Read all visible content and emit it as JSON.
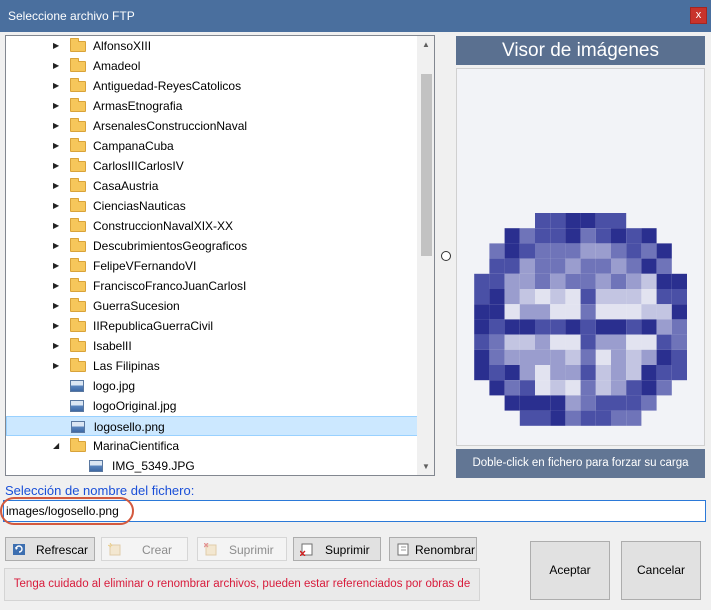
{
  "window": {
    "title": "Seleccione archivo FTP",
    "close_label": "x"
  },
  "tree": {
    "items": [
      {
        "label": "AlfonsoXIII",
        "type": "folder",
        "expander": "▶",
        "depth": 1
      },
      {
        "label": "Amadeol",
        "type": "folder",
        "expander": "▶",
        "depth": 1
      },
      {
        "label": "Antiguedad-ReyesCatolicos",
        "type": "folder",
        "expander": "▶",
        "depth": 1
      },
      {
        "label": "ArmasEtnografia",
        "type": "folder",
        "expander": "▶",
        "depth": 1
      },
      {
        "label": "ArsenalesConstruccionNaval",
        "type": "folder",
        "expander": "▶",
        "depth": 1
      },
      {
        "label": "CampanaCuba",
        "type": "folder",
        "expander": "▶",
        "depth": 1
      },
      {
        "label": "CarlosIIICarlosIV",
        "type": "folder",
        "expander": "▶",
        "depth": 1
      },
      {
        "label": "CasaAustria",
        "type": "folder",
        "expander": "▶",
        "depth": 1
      },
      {
        "label": "CienciasNauticas",
        "type": "folder",
        "expander": "▶",
        "depth": 1
      },
      {
        "label": "ConstruccionNavalXIX-XX",
        "type": "folder",
        "expander": "▶",
        "depth": 1
      },
      {
        "label": "DescubrimientosGeograficos",
        "type": "folder",
        "expander": "▶",
        "depth": 1
      },
      {
        "label": "FelipeVFernandoVI",
        "type": "folder",
        "expander": "▶",
        "depth": 1
      },
      {
        "label": "FranciscoFrancoJuanCarlosI",
        "type": "folder",
        "expander": "▶",
        "depth": 1
      },
      {
        "label": "GuerraSucesion",
        "type": "folder",
        "expander": "▶",
        "depth": 1
      },
      {
        "label": "IIRepublicaGuerraCivil",
        "type": "folder",
        "expander": "▶",
        "depth": 1
      },
      {
        "label": "IsabelII",
        "type": "folder",
        "expander": "▶",
        "depth": 1
      },
      {
        "label": "Las Filipinas",
        "type": "folder",
        "expander": "▶",
        "depth": 1
      },
      {
        "label": "logo.jpg",
        "type": "image",
        "expander": "",
        "depth": 1
      },
      {
        "label": "logoOriginal.jpg",
        "type": "image",
        "expander": "",
        "depth": 1
      },
      {
        "label": "logosello.png",
        "type": "image",
        "expander": "",
        "depth": 1,
        "selected": true
      },
      {
        "label": "MarinaCientifica",
        "type": "folder",
        "expander": "◢",
        "depth": 1
      },
      {
        "label": "IMG_5349.JPG",
        "type": "image",
        "expander": "",
        "depth": 2
      }
    ]
  },
  "viewer": {
    "title": "Visor de imágenes",
    "hint": "Doble-click en fichero para forzar su carga",
    "accent": "#1e2a8a"
  },
  "filename": {
    "label": "Selección de nombre del fichero:",
    "value": "images/logosello.png"
  },
  "buttons": {
    "refresh": "Refrescar",
    "create": "Crear",
    "delete_disabled": "Suprimir",
    "delete": "Suprimir",
    "rename": "Renombrar",
    "accept": "Aceptar",
    "cancel": "Cancelar"
  },
  "warning": "Tenga cuidado al eliminar o renombrar archivos, pueden estar referenciados por obras de arte",
  "colors": {
    "title_bar": "#4a6f9e",
    "warning_text": "#d81b3b",
    "selection": "#cce8ff",
    "label_blue": "#1a4fd8"
  }
}
